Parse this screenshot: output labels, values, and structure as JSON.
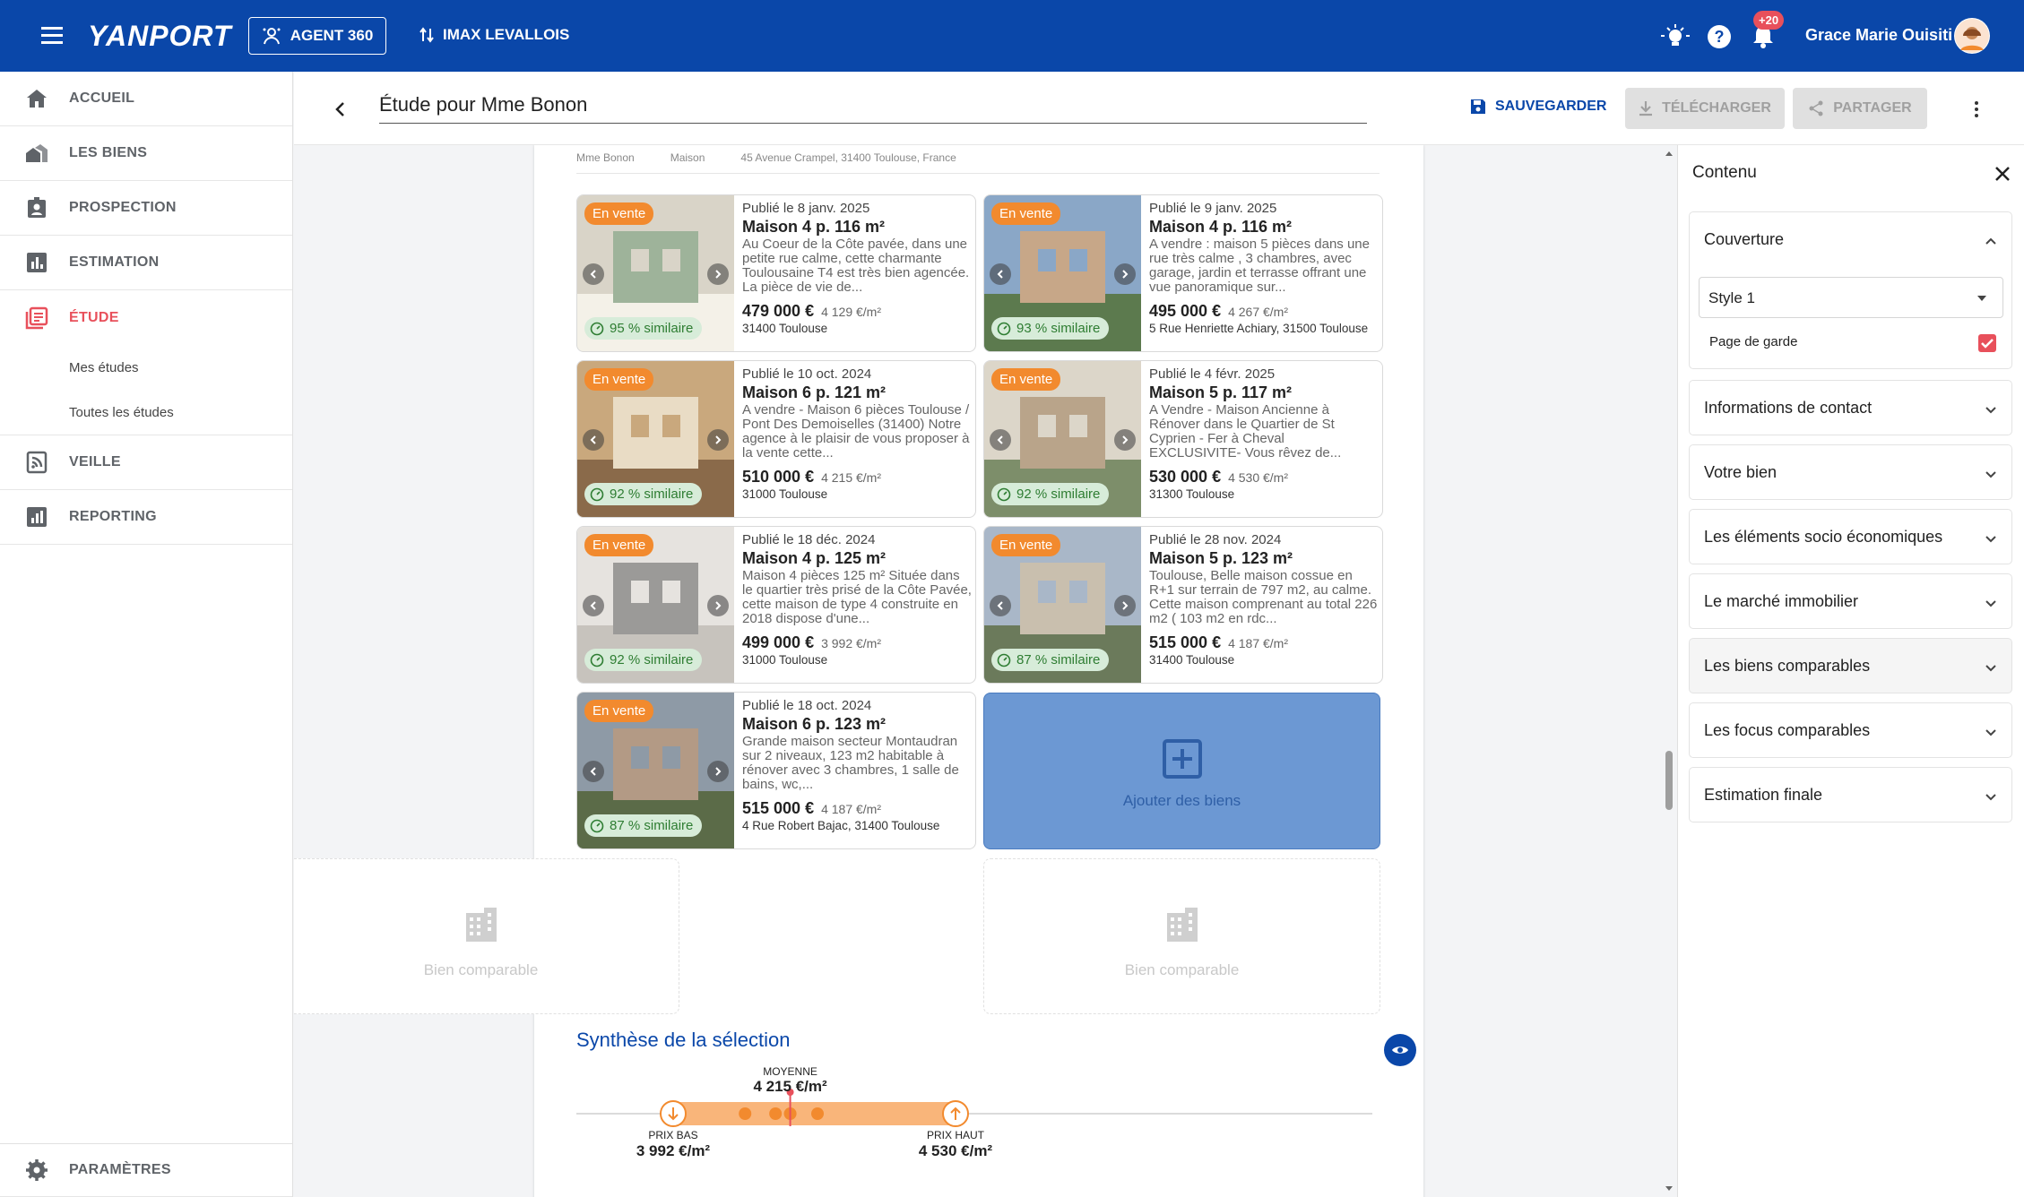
{
  "topbar": {
    "logo": "YANPORT",
    "agent_button": "AGENT 360",
    "agency": "IMAX LEVALLOIS",
    "notifications_badge": "+20",
    "user_name": "Grace Marie Ouisiti"
  },
  "sidebar": {
    "items": [
      {
        "label": "ACCUEIL",
        "icon": "home-icon"
      },
      {
        "label": "LES BIENS",
        "icon": "houses-icon"
      },
      {
        "label": "PROSPECTION",
        "icon": "contact-badge-icon"
      },
      {
        "label": "ESTIMATION",
        "icon": "chart-icon"
      },
      {
        "label": "ÉTUDE",
        "icon": "study-list-icon"
      },
      {
        "label": "VEILLE",
        "icon": "rss-icon"
      },
      {
        "label": "REPORTING",
        "icon": "report-chart-icon"
      }
    ],
    "sub_items": [
      "Mes études",
      "Toutes les études"
    ],
    "settings_label": "PARAMÈTRES"
  },
  "header": {
    "title": "Étude pour Mme Bonon",
    "save": "SAUVEGARDER",
    "download": "TÉLÉCHARGER",
    "share": "PARTAGER"
  },
  "page_strip": [
    "Mme Bonon",
    "Maison",
    "45 Avenue Crampel, 31400 Toulouse, France"
  ],
  "cards": [
    {
      "status": "En vente",
      "published": "Publié le 8 janv. 2025",
      "title": "Maison 4 p. 116 m²",
      "description": "Au Coeur de la Côte pavée, dans une petite rue calme, cette charmante Toulousaine T4 est très bien agencée. La pièce de vie de...",
      "price": "479 000 €",
      "price_m2": "4 129 €/m²",
      "address": "31400 Toulouse",
      "similarity": "95 % similaire"
    },
    {
      "status": "En vente",
      "published": "Publié le 9 janv. 2025",
      "title": "Maison 4 p. 116 m²",
      "description": "A vendre : maison 5 pièces dans une rue très calme , 3 chambres, avec garage, jardin et terrasse offrant une vue panoramique sur...",
      "price": "495 000 €",
      "price_m2": "4 267 €/m²",
      "address": "5 Rue Henriette Achiary, 31500 Toulouse",
      "similarity": "93 % similaire"
    },
    {
      "status": "En vente",
      "published": "Publié le 10 oct. 2024",
      "title": "Maison 6 p. 121 m²",
      "description": "A vendre - Maison 6 pièces Toulouse / Pont Des Demoiselles (31400) Notre agence à le plaisir de vous proposer à la vente cette...",
      "price": "510 000 €",
      "price_m2": "4 215 €/m²",
      "address": "31000 Toulouse",
      "similarity": "92 % similaire"
    },
    {
      "status": "En vente",
      "published": "Publié le 4 févr. 2025",
      "title": "Maison 5 p. 117 m²",
      "description": "A Vendre - Maison Ancienne à Rénover dans le Quartier de St Cyprien - Fer à Cheval EXCLUSIVITE- Vous rêvez de...",
      "price": "530 000 €",
      "price_m2": "4 530 €/m²",
      "address": "31300 Toulouse",
      "similarity": "92 % similaire"
    },
    {
      "status": "En vente",
      "published": "Publié le 18 déc. 2024",
      "title": "Maison 4 p. 125 m²",
      "description": "Maison 4 pièces 125 m² Située dans le quartier très prisé de la Côte Pavée, cette maison de type 4 construite en 2018 dispose d'une...",
      "price": "499 000 €",
      "price_m2": "3 992 €/m²",
      "address": "31000 Toulouse",
      "similarity": "92 % similaire"
    },
    {
      "status": "En vente",
      "published": "Publié le 28 nov. 2024",
      "title": "Maison 5 p. 123 m²",
      "description": "Toulouse, Belle maison cossue en R+1 sur terrain de 797 m2, au calme. Cette maison comprenant au total 226 m2 ( 103 m2 en rdc...",
      "price": "515 000 €",
      "price_m2": "4 187 €/m²",
      "address": "31400 Toulouse",
      "similarity": "87 % similaire"
    },
    {
      "status": "En vente",
      "published": "Publié le 18 oct. 2024",
      "title": "Maison 6 p. 123 m²",
      "description": "Grande maison secteur Montaudran sur 2 niveaux, 123 m2 habitable à rénover avec 3 chambres, 1 salle de bains, wc,...",
      "price": "515 000 €",
      "price_m2": "4 187 €/m²",
      "address": "4 Rue Robert Bajac, 31400 Toulouse",
      "similarity": "87 % similaire"
    }
  ],
  "add_card_label": "Ajouter des biens",
  "placeholder_label": "Bien comparable",
  "synthesis": {
    "title": "Synthèse de la sélection",
    "avg_label": "MOYENNE",
    "avg_value": "4 215 €/m²",
    "low_label": "PRIX BAS",
    "low_value": "3 992 €/m²",
    "high_label": "PRIX HAUT",
    "high_value": "4 530 €/m²",
    "low_num": 3992,
    "high_num": 4530,
    "avg_num": 4215,
    "points": [
      4129,
      4187,
      4215,
      4267
    ]
  },
  "panel": {
    "title": "Contenu",
    "coverage": "Couverture",
    "style_value": "Style 1",
    "cover_page": "Page de garde",
    "sections": [
      "Informations de contact",
      "Votre bien",
      "Les éléments socio économiques",
      "Le marché immobilier",
      "Les biens comparables",
      "Les focus comparables",
      "Estimation finale"
    ]
  },
  "colors": {
    "primary": "#0a47a9",
    "accent": "#e8505b",
    "orange": "#f28a2e"
  }
}
